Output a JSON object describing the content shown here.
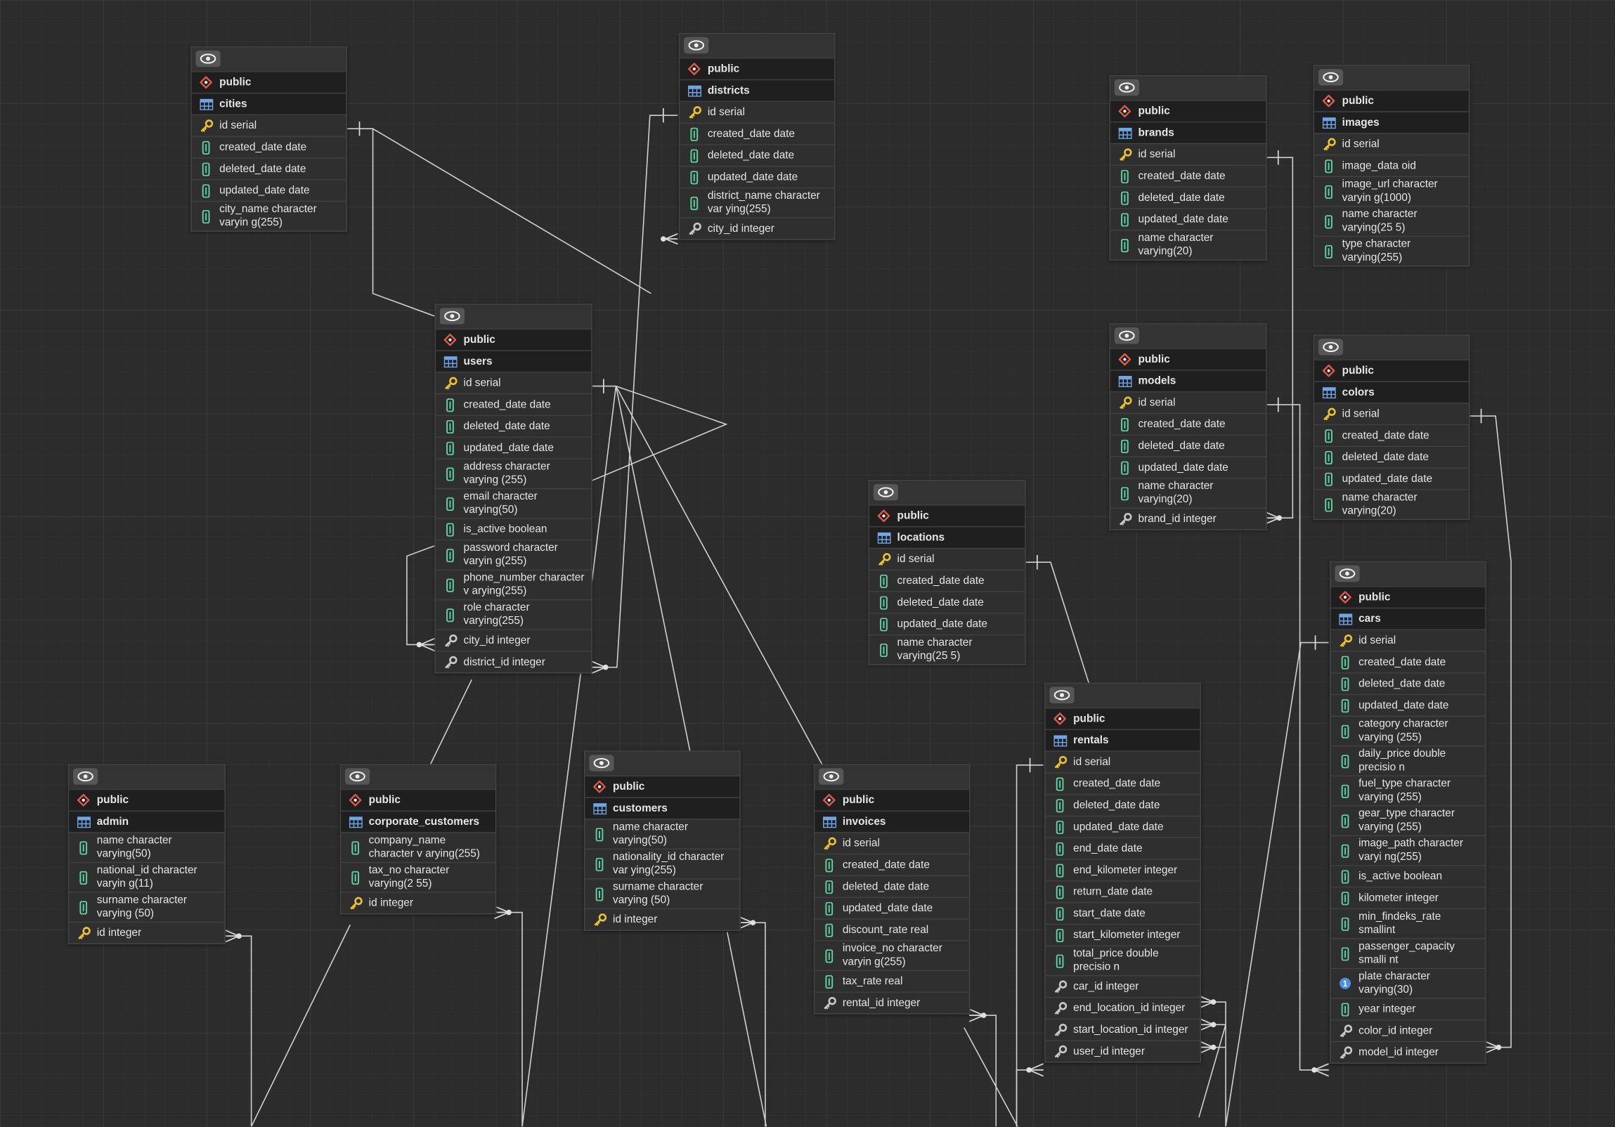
{
  "diagram": {
    "tables": [
      {
        "key": "cities",
        "schema": "public",
        "name": "cities",
        "columns": [
          {
            "text": "id serial",
            "icon": "primary-key-icon"
          },
          {
            "text": "created_date date",
            "icon": "column-icon"
          },
          {
            "text": "deleted_date date",
            "icon": "column-icon"
          },
          {
            "text": "updated_date date",
            "icon": "column-icon"
          },
          {
            "text": "city_name character varyin g(255)",
            "icon": "column-icon"
          }
        ]
      },
      {
        "key": "districts",
        "schema": "public",
        "name": "districts",
        "columns": [
          {
            "text": "id serial",
            "icon": "primary-key-icon"
          },
          {
            "text": "created_date date",
            "icon": "column-icon"
          },
          {
            "text": "deleted_date date",
            "icon": "column-icon"
          },
          {
            "text": "updated_date date",
            "icon": "column-icon"
          },
          {
            "text": "district_name character var ying(255)",
            "icon": "column-icon"
          },
          {
            "text": "city_id integer",
            "icon": "foreign-key-icon"
          }
        ]
      },
      {
        "key": "brands",
        "schema": "public",
        "name": "brands",
        "columns": [
          {
            "text": "id serial",
            "icon": "primary-key-icon"
          },
          {
            "text": "created_date date",
            "icon": "column-icon"
          },
          {
            "text": "deleted_date date",
            "icon": "column-icon"
          },
          {
            "text": "updated_date date",
            "icon": "column-icon"
          },
          {
            "text": "name character varying(20)",
            "icon": "column-icon"
          }
        ]
      },
      {
        "key": "images",
        "schema": "public",
        "name": "images",
        "columns": [
          {
            "text": "id serial",
            "icon": "primary-key-icon"
          },
          {
            "text": "image_data oid",
            "icon": "column-icon"
          },
          {
            "text": "image_url character varyin g(1000)",
            "icon": "column-icon"
          },
          {
            "text": "name character varying(25 5)",
            "icon": "column-icon"
          },
          {
            "text": "type character varying(255)",
            "icon": "column-icon"
          }
        ]
      },
      {
        "key": "models",
        "schema": "public",
        "name": "models",
        "columns": [
          {
            "text": "id serial",
            "icon": "primary-key-icon"
          },
          {
            "text": "created_date date",
            "icon": "column-icon"
          },
          {
            "text": "deleted_date date",
            "icon": "column-icon"
          },
          {
            "text": "updated_date date",
            "icon": "column-icon"
          },
          {
            "text": "name character varying(20)",
            "icon": "column-icon"
          },
          {
            "text": "brand_id integer",
            "icon": "foreign-key-icon"
          }
        ]
      },
      {
        "key": "colors",
        "schema": "public",
        "name": "colors",
        "columns": [
          {
            "text": "id serial",
            "icon": "primary-key-icon"
          },
          {
            "text": "created_date date",
            "icon": "column-icon"
          },
          {
            "text": "deleted_date date",
            "icon": "column-icon"
          },
          {
            "text": "updated_date date",
            "icon": "column-icon"
          },
          {
            "text": "name character varying(20)",
            "icon": "column-icon"
          }
        ]
      },
      {
        "key": "users",
        "schema": "public",
        "name": "users",
        "columns": [
          {
            "text": "id serial",
            "icon": "primary-key-icon"
          },
          {
            "text": "created_date date",
            "icon": "column-icon"
          },
          {
            "text": "deleted_date date",
            "icon": "column-icon"
          },
          {
            "text": "updated_date date",
            "icon": "column-icon"
          },
          {
            "text": "address character varying (255)",
            "icon": "column-icon"
          },
          {
            "text": "email character varying(50)",
            "icon": "column-icon"
          },
          {
            "text": "is_active boolean",
            "icon": "column-icon"
          },
          {
            "text": "password character varyin g(255)",
            "icon": "column-icon"
          },
          {
            "text": "phone_number character v arying(255)",
            "icon": "column-icon"
          },
          {
            "text": "role character varying(255)",
            "icon": "column-icon"
          },
          {
            "text": "city_id integer",
            "icon": "foreign-key-icon"
          },
          {
            "text": "district_id integer",
            "icon": "foreign-key-icon"
          }
        ]
      },
      {
        "key": "locations",
        "schema": "public",
        "name": "locations",
        "columns": [
          {
            "text": "id serial",
            "icon": "primary-key-icon"
          },
          {
            "text": "created_date date",
            "icon": "column-icon"
          },
          {
            "text": "deleted_date date",
            "icon": "column-icon"
          },
          {
            "text": "updated_date date",
            "icon": "column-icon"
          },
          {
            "text": "name character varying(25 5)",
            "icon": "column-icon"
          }
        ]
      },
      {
        "key": "cars",
        "schema": "public",
        "name": "cars",
        "columns": [
          {
            "text": "id serial",
            "icon": "primary-key-icon"
          },
          {
            "text": "created_date date",
            "icon": "column-icon"
          },
          {
            "text": "deleted_date date",
            "icon": "column-icon"
          },
          {
            "text": "updated_date date",
            "icon": "column-icon"
          },
          {
            "text": "category character varying (255)",
            "icon": "column-icon"
          },
          {
            "text": "daily_price double precisio n",
            "icon": "column-icon"
          },
          {
            "text": "fuel_type character varying (255)",
            "icon": "column-icon"
          },
          {
            "text": "gear_type character varying (255)",
            "icon": "column-icon"
          },
          {
            "text": "image_path character varyi ng(255)",
            "icon": "column-icon"
          },
          {
            "text": "is_active boolean",
            "icon": "column-icon"
          },
          {
            "text": "kilometer integer",
            "icon": "column-icon"
          },
          {
            "text": "min_findeks_rate smallint",
            "icon": "column-icon"
          },
          {
            "text": "passenger_capacity smalli nt",
            "icon": "column-icon"
          },
          {
            "text": "plate character varying(30)",
            "icon": "unique-key-icon"
          },
          {
            "text": "year integer",
            "icon": "column-icon"
          },
          {
            "text": "color_id integer",
            "icon": "foreign-key-icon"
          },
          {
            "text": "model_id integer",
            "icon": "foreign-key-icon"
          }
        ]
      },
      {
        "key": "rentals",
        "schema": "public",
        "name": "rentals",
        "columns": [
          {
            "text": "id serial",
            "icon": "primary-key-icon"
          },
          {
            "text": "created_date date",
            "icon": "column-icon"
          },
          {
            "text": "deleted_date date",
            "icon": "column-icon"
          },
          {
            "text": "updated_date date",
            "icon": "column-icon"
          },
          {
            "text": "end_date date",
            "icon": "column-icon"
          },
          {
            "text": "end_kilometer integer",
            "icon": "column-icon"
          },
          {
            "text": "return_date date",
            "icon": "column-icon"
          },
          {
            "text": "start_date date",
            "icon": "column-icon"
          },
          {
            "text": "start_kilometer integer",
            "icon": "column-icon"
          },
          {
            "text": "total_price double precisio n",
            "icon": "column-icon"
          },
          {
            "text": "car_id integer",
            "icon": "foreign-key-icon"
          },
          {
            "text": "end_location_id integer",
            "icon": "foreign-key-icon"
          },
          {
            "text": "start_location_id integer",
            "icon": "foreign-key-icon"
          },
          {
            "text": "user_id integer",
            "icon": "foreign-key-icon"
          }
        ]
      },
      {
        "key": "admin",
        "schema": "public",
        "name": "admin",
        "columns": [
          {
            "text": "name character varying(50)",
            "icon": "column-icon"
          },
          {
            "text": "national_id character varyin g(11)",
            "icon": "column-icon"
          },
          {
            "text": "surname character varying (50)",
            "icon": "column-icon"
          },
          {
            "text": "id integer",
            "icon": "primary-key-icon"
          }
        ]
      },
      {
        "key": "corporate_customers",
        "schema": "public",
        "name": "corporate_customers",
        "columns": [
          {
            "text": "company_name character v arying(255)",
            "icon": "column-icon"
          },
          {
            "text": "tax_no character varying(2 55)",
            "icon": "column-icon"
          },
          {
            "text": "id integer",
            "icon": "primary-key-icon"
          }
        ]
      },
      {
        "key": "customers",
        "schema": "public",
        "name": "customers",
        "columns": [
          {
            "text": "name character varying(50)",
            "icon": "column-icon"
          },
          {
            "text": "nationality_id character var ying(255)",
            "icon": "column-icon"
          },
          {
            "text": "surname character varying (50)",
            "icon": "column-icon"
          },
          {
            "text": "id integer",
            "icon": "primary-key-icon"
          }
        ]
      },
      {
        "key": "invoices",
        "schema": "public",
        "name": "invoices",
        "columns": [
          {
            "text": "id serial",
            "icon": "primary-key-icon"
          },
          {
            "text": "created_date date",
            "icon": "column-icon"
          },
          {
            "text": "deleted_date date",
            "icon": "column-icon"
          },
          {
            "text": "updated_date date",
            "icon": "column-icon"
          },
          {
            "text": "discount_rate real",
            "icon": "column-icon"
          },
          {
            "text": "invoice_no character varyin g(255)",
            "icon": "column-icon"
          },
          {
            "text": "tax_rate real",
            "icon": "column-icon"
          },
          {
            "text": "rental_id integer",
            "icon": "foreign-key-icon"
          }
        ]
      }
    ]
  },
  "colors": {
    "canvas_bg": "#2c2c2c",
    "table_bg": "#2f2f2f",
    "header_row_bg": "#1f1f1f",
    "text": "#e6e6e6",
    "connector": "#d0d0d0",
    "schema_icon": "#e15a4b",
    "table_icon": "#6fa6e8",
    "primary_key": "#e8c233",
    "column_icon": "#5fd3a8",
    "unique_key": "#4a8fe0",
    "foreign_key": "#c8c8c8"
  }
}
